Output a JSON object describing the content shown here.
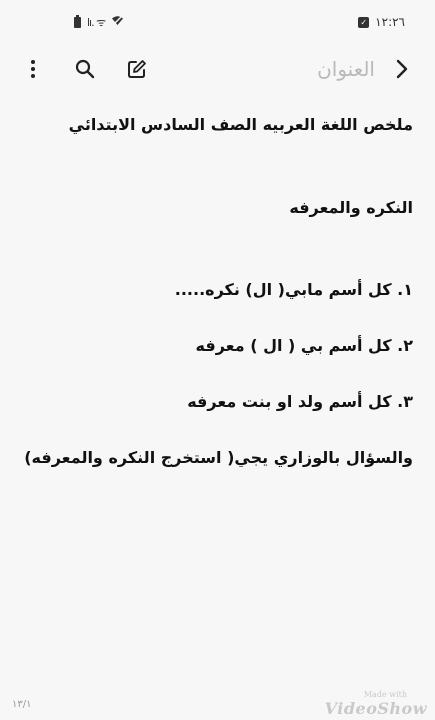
{
  "status_bar": {
    "time": "١٢:٢٦",
    "signal": "lı. ᯤ"
  },
  "app_bar": {
    "title": "العنوان"
  },
  "note": {
    "lines": [
      "ملخص اللغة العربيه الصف السادس الابتدائي",
      "النكره والمعرفه",
      "١. كل أسم مابي( ال) نكره.....",
      "٢. كل أسم بي ( ال ) معرفه",
      "٣. كل أسم ولد او بنت معرفه",
      "والسؤال بالوزاري يجي( استخرج النكره والمعرفه)"
    ]
  },
  "footer": {
    "page_counter": "١٣/١"
  },
  "watermark": {
    "small": "Made with",
    "main": "VideoShow"
  },
  "colors": {
    "background": "#f7f7f7",
    "title_placeholder": "#b9b9b9",
    "text": "#111111"
  }
}
